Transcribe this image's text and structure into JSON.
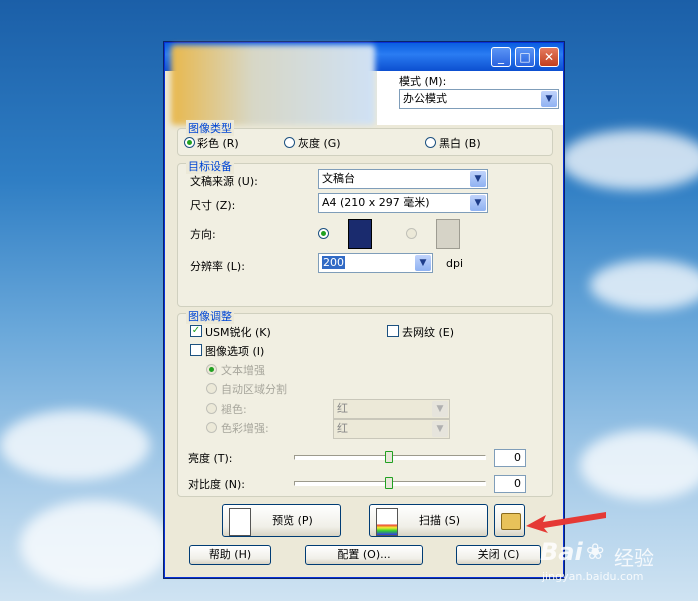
{
  "window": {
    "mode_label": "模式 (M):",
    "mode_value": "办公模式",
    "image_type": {
      "title": "图像类型",
      "options": [
        "彩色 (R)",
        "灰度 (G)",
        "黑白 (B)"
      ],
      "selected": 0
    },
    "target": {
      "title": "目标设备",
      "source_label": "文稿来源 (U):",
      "source_value": "文稿台",
      "size_label": "尺寸 (Z):",
      "size_value": "A4 (210 x 297 毫米)",
      "orientation_label": "方向:",
      "resolution_label": "分辨率 (L):",
      "resolution_value": "200",
      "resolution_unit": "dpi"
    },
    "adjust": {
      "title": "图像调整",
      "usm_label": "USM锐化 (K)",
      "usm_checked": true,
      "descreen_label": "去网纹 (E)",
      "image_options_label": "图像选项 (I)",
      "text_enhance": "文本增强",
      "auto_area": "自动区域分割",
      "dropout": "褪色:",
      "dropout_value": "红",
      "color_enhance": "色彩增强:",
      "color_enhance_value": "红",
      "brightness_label": "亮度 (T):",
      "brightness_value": "0",
      "contrast_label": "对比度 (N):",
      "contrast_value": "0"
    },
    "buttons": {
      "preview": "预览 (P)",
      "scan": "扫描 (S)",
      "help": "帮助 (H)",
      "config": "配置 (O)...",
      "close": "关闭 (C)"
    }
  },
  "watermark": {
    "brand": "Bai",
    "brand2": "经验",
    "url": "jingyan.baidu.com"
  },
  "colors": {
    "accent": "#0046d5",
    "check": "#21a121",
    "arrow": "#e53935"
  }
}
